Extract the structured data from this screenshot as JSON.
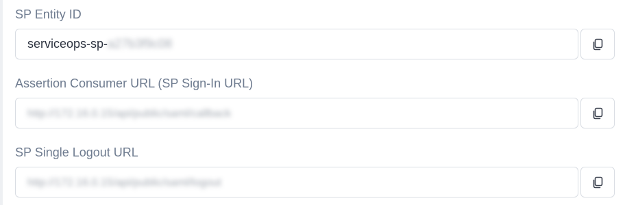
{
  "fields": [
    {
      "label": "SP Entity ID",
      "value_visible": "serviceops-sp-",
      "value_redacted": "a27b3f9c08",
      "copy_icon": "copy-icon"
    },
    {
      "label": "Assertion Consumer URL (SP Sign-In URL)",
      "value_redacted": "http://172.16.0.15/api/public/saml/callback",
      "copy_icon": "copy-icon"
    },
    {
      "label": "SP Single Logout URL",
      "value_redacted": "http://172.16.0.15/api/public/saml/logout",
      "copy_icon": "copy-icon"
    }
  ]
}
